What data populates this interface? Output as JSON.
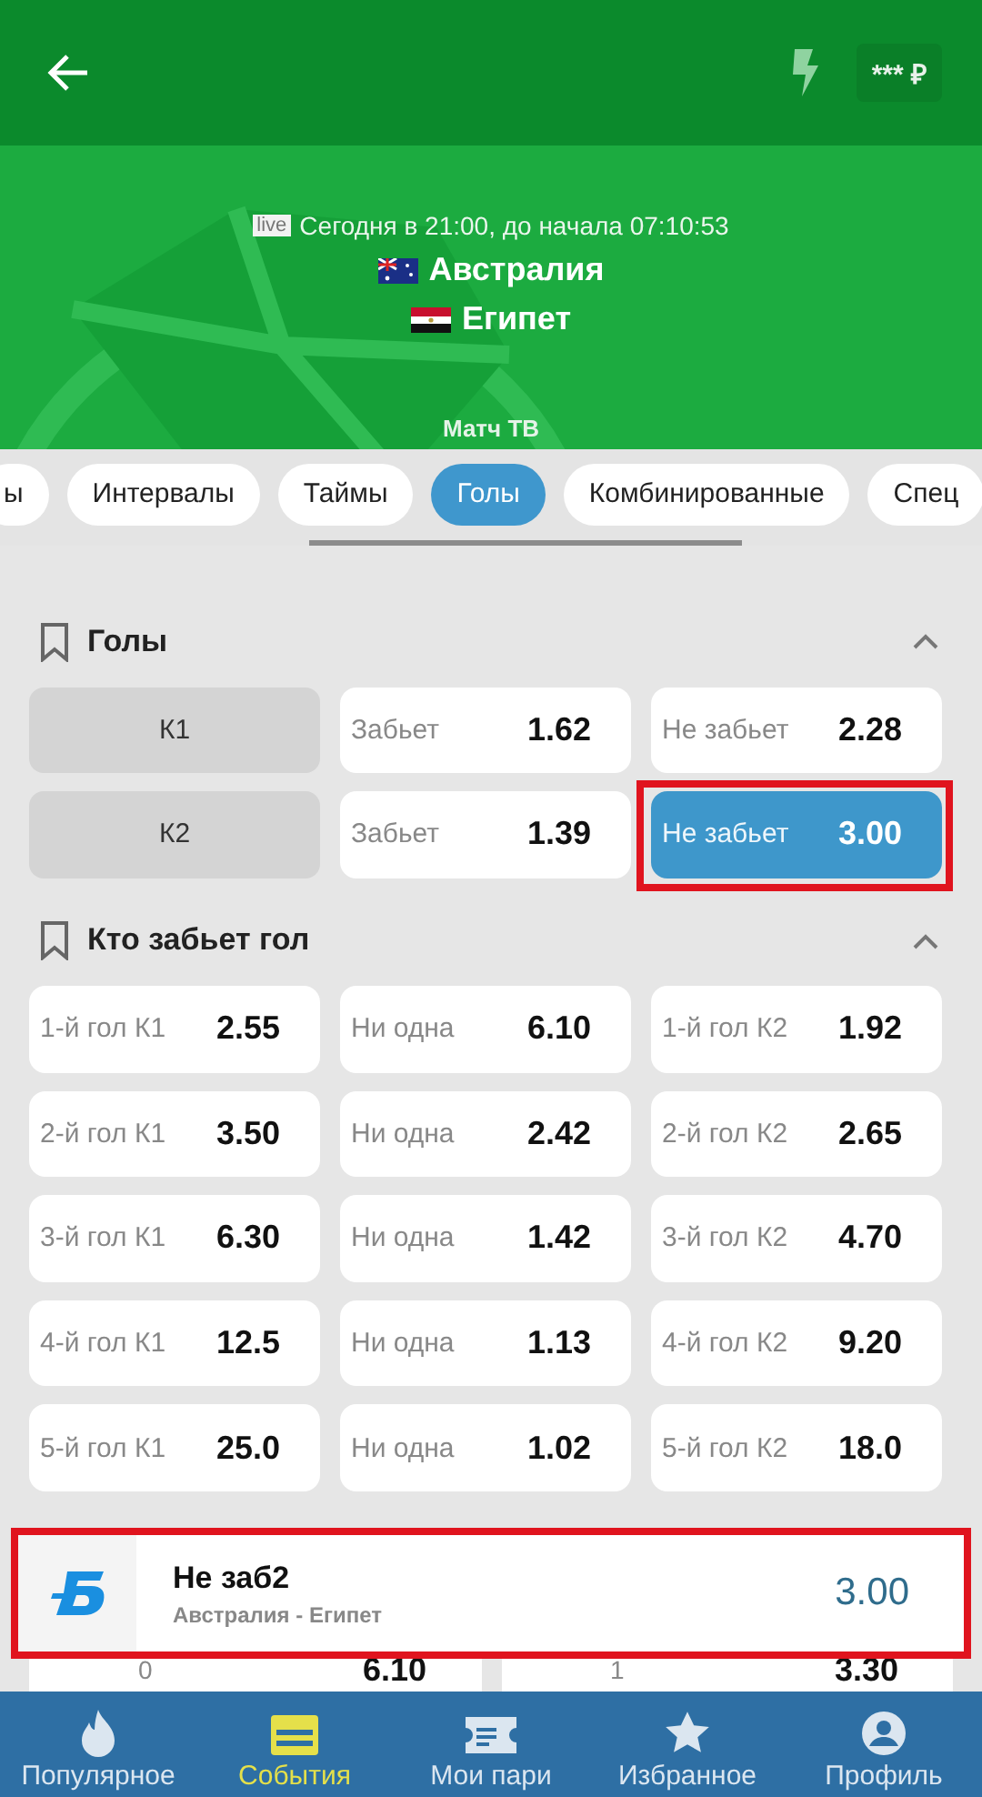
{
  "header": {
    "balance": "*** ₽"
  },
  "match": {
    "live_badge": "live",
    "time": "Сегодня в 21:00, до начала 07:10:53",
    "teams": [
      {
        "name": "Австралия"
      },
      {
        "name": "Египет"
      }
    ],
    "channel": "Матч ТВ"
  },
  "tabs": [
    {
      "label": "ы",
      "selected": false
    },
    {
      "label": "Интервалы",
      "selected": false
    },
    {
      "label": "Таймы",
      "selected": false
    },
    {
      "label": "Голы",
      "selected": true
    },
    {
      "label": "Комбинированные",
      "selected": false
    },
    {
      "label": "Спец",
      "selected": false
    }
  ],
  "markets": [
    {
      "title": "Голы",
      "expanded": true,
      "rows": [
        [
          {
            "kind": "label",
            "text": "К1"
          },
          {
            "kind": "odd",
            "label": "Забьет",
            "value": "1.62",
            "selected": false,
            "highlighted": false
          },
          {
            "kind": "odd",
            "label": "Не забьет",
            "value": "2.28",
            "selected": false,
            "highlighted": false
          }
        ],
        [
          {
            "kind": "label",
            "text": "К2"
          },
          {
            "kind": "odd",
            "label": "Забьет",
            "value": "1.39",
            "selected": false,
            "highlighted": false
          },
          {
            "kind": "odd",
            "label": "Не забьет",
            "value": "3.00",
            "selected": true,
            "highlighted": true
          }
        ]
      ]
    },
    {
      "title": "Кто забьет гол",
      "expanded": true,
      "rows": [
        [
          {
            "kind": "odd",
            "label": "1-й гол К1",
            "value": "2.55",
            "selected": false,
            "highlighted": false
          },
          {
            "kind": "odd",
            "label": "Ни одна",
            "value": "6.10",
            "selected": false,
            "highlighted": false
          },
          {
            "kind": "odd",
            "label": "1-й гол К2",
            "value": "1.92",
            "selected": false,
            "highlighted": false
          }
        ],
        [
          {
            "kind": "odd",
            "label": "2-й гол К1",
            "value": "3.50",
            "selected": false,
            "highlighted": false
          },
          {
            "kind": "odd",
            "label": "Ни одна",
            "value": "2.42",
            "selected": false,
            "highlighted": false
          },
          {
            "kind": "odd",
            "label": "2-й гол К2",
            "value": "2.65",
            "selected": false,
            "highlighted": false
          }
        ],
        [
          {
            "kind": "odd",
            "label": "3-й гол К1",
            "value": "6.30",
            "selected": false,
            "highlighted": false
          },
          {
            "kind": "odd",
            "label": "Ни одна",
            "value": "1.42",
            "selected": false,
            "highlighted": false
          },
          {
            "kind": "odd",
            "label": "3-й гол К2",
            "value": "4.70",
            "selected": false,
            "highlighted": false
          }
        ],
        [
          {
            "kind": "odd",
            "label": "4-й гол К1",
            "value": "12.5",
            "selected": false,
            "highlighted": false
          },
          {
            "kind": "odd",
            "label": "Ни одна",
            "value": "1.13",
            "selected": false,
            "highlighted": false
          },
          {
            "kind": "odd",
            "label": "4-й гол К2",
            "value": "9.20",
            "selected": false,
            "highlighted": false
          }
        ],
        [
          {
            "kind": "odd",
            "label": "5-й гол К1",
            "value": "25.0",
            "selected": false,
            "highlighted": false
          },
          {
            "kind": "odd",
            "label": "Ни одна",
            "value": "1.02",
            "selected": false,
            "highlighted": false
          },
          {
            "kind": "odd",
            "label": "5-й гол К2",
            "value": "18.0",
            "selected": false,
            "highlighted": false
          }
        ]
      ]
    }
  ],
  "bet_slip": {
    "title": "Не заб2",
    "subtitle": "Австралия - Египет",
    "value": "3.00",
    "highlighted": true
  },
  "partial_row": [
    {
      "label": "0",
      "value": "6.10"
    },
    {
      "label": "1",
      "value": "3.30"
    }
  ],
  "nav": [
    {
      "label": "Популярное",
      "selected": false
    },
    {
      "label": "События",
      "selected": true
    },
    {
      "label": "Мои пари",
      "selected": false
    },
    {
      "label": "Избранное",
      "selected": false
    },
    {
      "label": "Профиль",
      "selected": false
    }
  ]
}
